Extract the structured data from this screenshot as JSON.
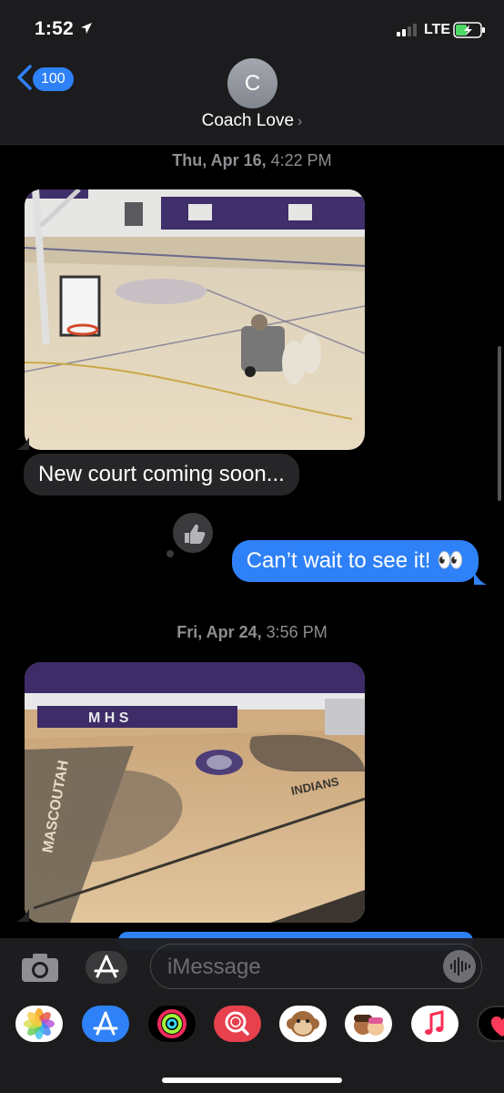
{
  "status_bar": {
    "time": "1:52",
    "network": "LTE",
    "location_icon": "location-arrow-icon",
    "battery_icon": "battery-charging-icon"
  },
  "header": {
    "back_count": "100",
    "avatar_initial": "C",
    "contact_name": "Coach Love",
    "chevron": "›"
  },
  "messages": {
    "stamp1_day": "Thu, Apr 16,",
    "stamp1_time": " 4:22 PM",
    "photo1_desc": "gym-floor-sanding-photo",
    "received_text": "New court coming soon...",
    "reaction_icon": "thumbs-up-icon",
    "sent_text": "Can’t wait to see it! 👀",
    "stamp2_day": "Fri, Apr 24,",
    "stamp2_time": " 3:56 PM",
    "photo2_desc": "finished-basketball-court-photo",
    "photo2_baseline": "MASCOUTAH",
    "photo2_lane": "INDIANS",
    "photo2_banner": "M H S"
  },
  "input": {
    "placeholder": "iMessage"
  },
  "app_drawer": [
    "photos",
    "app-store",
    "activity",
    "search-images",
    "animoji",
    "memoji",
    "music",
    "digital-touch"
  ],
  "colors": {
    "sent_bubble": "#2f81f7",
    "received_bubble": "#262629",
    "background": "#000000"
  }
}
